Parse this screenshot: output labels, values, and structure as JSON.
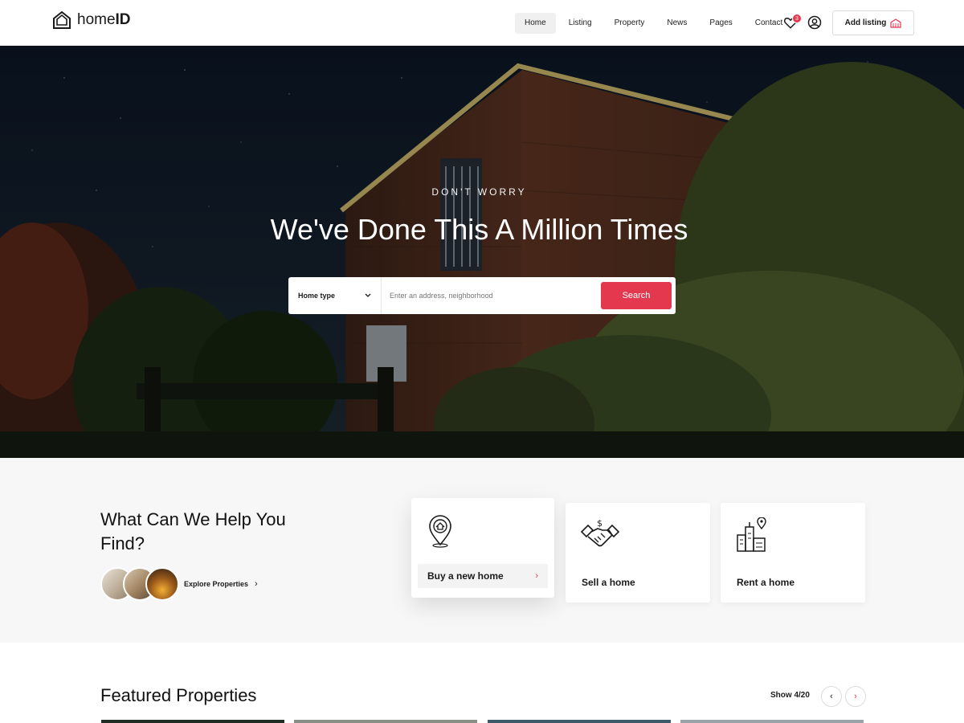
{
  "header": {
    "logo_light": "home",
    "logo_bold": "ID",
    "nav": [
      {
        "label": "Home",
        "active": true
      },
      {
        "label": "Listing"
      },
      {
        "label": "Property"
      },
      {
        "label": "News"
      },
      {
        "label": "Pages"
      },
      {
        "label": "Contact"
      }
    ],
    "wishlist_count": "3",
    "add_listing_label": "Add listing",
    "icons": {
      "wishlist": "heart-icon",
      "account": "user-circle-icon",
      "add_listing": "house-icon",
      "logo": "house-outline-icon"
    }
  },
  "hero": {
    "kicker": "DON'T WORRY",
    "title": "We've Done This A Million Times",
    "search": {
      "home_type_label": "Home type",
      "address_placeholder": "Enter an address, neighborhood",
      "address_value": "",
      "button_label": "Search"
    }
  },
  "help": {
    "title": "What Can We Help You Find?",
    "explore_label": "Explore Properties",
    "cards": [
      {
        "label": "Buy a new home",
        "icon": "map-pin-house-icon",
        "active": true
      },
      {
        "label": "Sell a home",
        "icon": "handshake-dollar-icon"
      },
      {
        "label": "Rent a home",
        "icon": "city-pin-icon"
      }
    ]
  },
  "featured": {
    "title": "Featured Properties",
    "show_count": "Show 4/20"
  },
  "colors": {
    "accent": "#e4384f",
    "text": "#1a1a1a",
    "section_bg": "#f7f7f7"
  }
}
